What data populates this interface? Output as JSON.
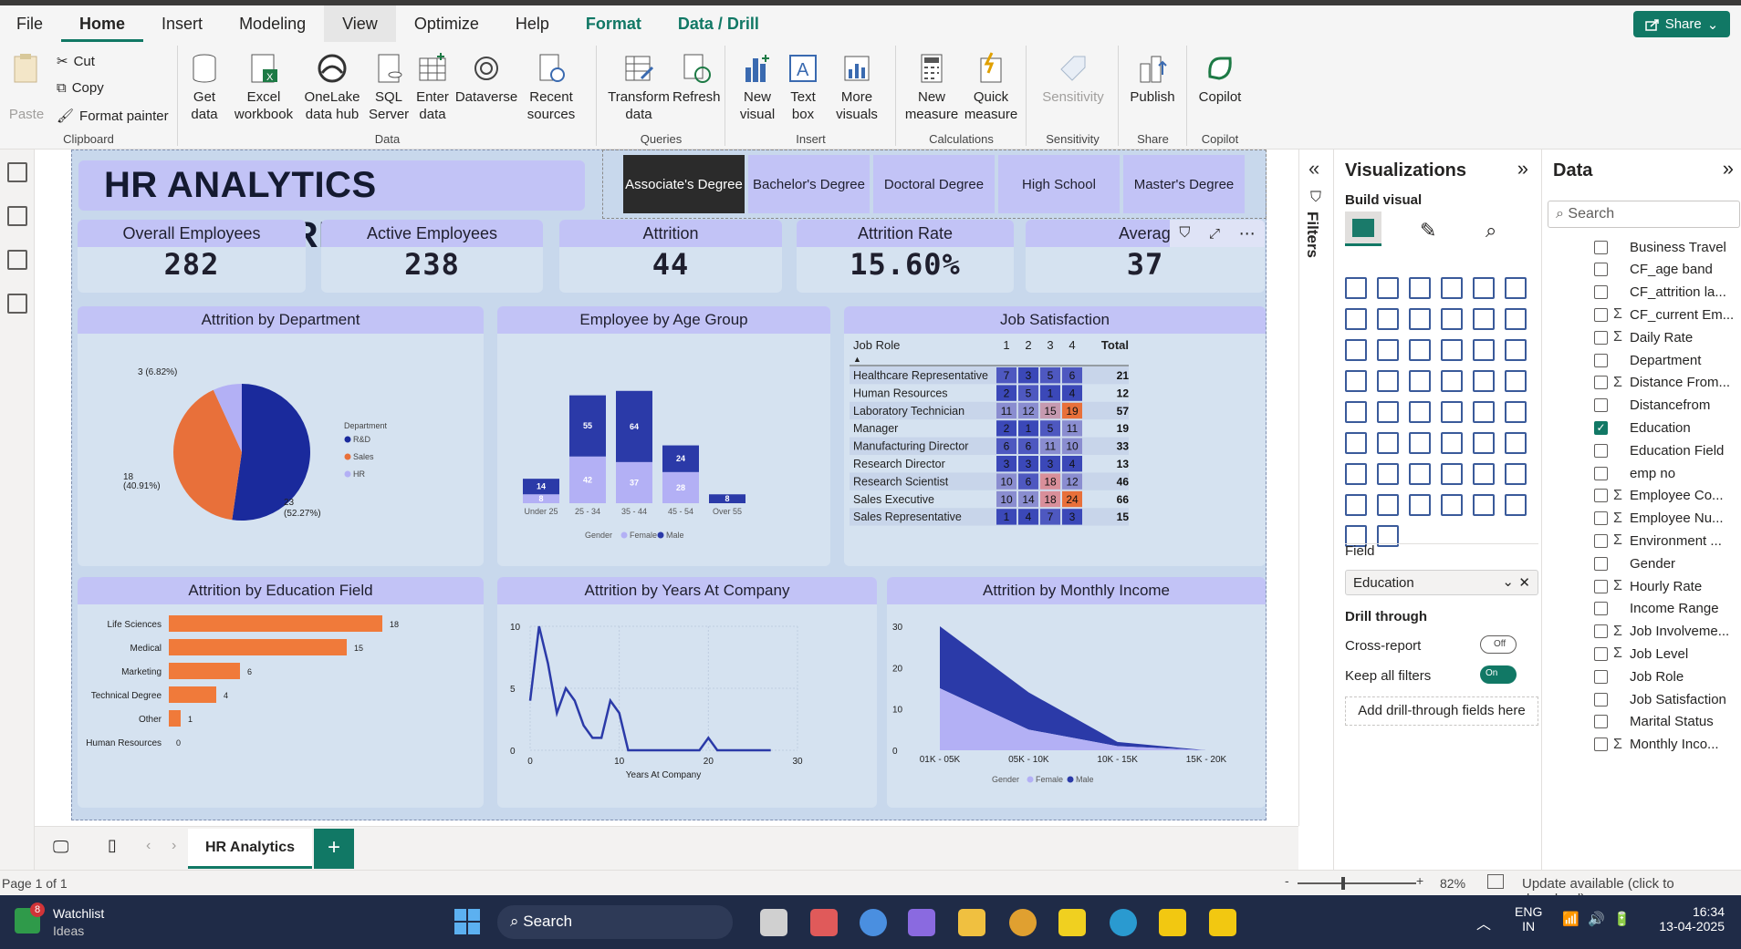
{
  "menu": {
    "items": [
      "File",
      "Home",
      "Insert",
      "Modeling",
      "View",
      "Optimize",
      "Help",
      "Format",
      "Data / Drill"
    ],
    "share": "Share"
  },
  "ribbon": {
    "clipboard": {
      "paste": "Paste",
      "cut": "Cut",
      "copy": "Copy",
      "format_painter": "Format painter",
      "label": "Clipboard"
    },
    "data": {
      "get_data": "Get data",
      "excel": "Excel workbook",
      "onelake": "OneLake data hub",
      "sql": "SQL Server",
      "enter": "Enter data",
      "dataverse": "Dataverse",
      "recent": "Recent sources",
      "label": "Data"
    },
    "queries": {
      "transform": "Transform data",
      "refresh": "Refresh",
      "label": "Queries"
    },
    "insert": {
      "new_visual": "New visual",
      "text_box": "Text box",
      "more_visuals": "More visuals",
      "label": "Insert"
    },
    "calculations": {
      "new_measure": "New measure",
      "quick_measure": "Quick measure",
      "label": "Calculations"
    },
    "sensitivity": {
      "btn": "Sensitivity",
      "label": "Sensitivity"
    },
    "share": {
      "publish": "Publish",
      "label": "Share"
    },
    "copilot": {
      "btn": "Copilot",
      "label": "Copilot"
    }
  },
  "dashboard": {
    "title": "HR ANALYTICS DASHBOARD",
    "slicers": [
      "Associate's Degree",
      "Bachelor's Degree",
      "Doctoral Degree",
      "High School",
      "Master's Degree"
    ],
    "kpis": [
      {
        "label": "Overall Employees",
        "value": "282"
      },
      {
        "label": "Active Employees",
        "value": "238"
      },
      {
        "label": "Attrition",
        "value": "44"
      },
      {
        "label": "Attrition Rate",
        "value": "15.60%"
      },
      {
        "label": "Average A",
        "value": "37"
      }
    ]
  },
  "pie_panel": {
    "title": "Attrition by Department",
    "legend_title": "Department",
    "legend": [
      "R&D",
      "Sales",
      "HR"
    ],
    "chart_data": {
      "type": "pie",
      "categories": [
        "R&D",
        "Sales",
        "HR"
      ],
      "values": [
        23,
        18,
        3
      ],
      "labels": [
        "23\n(52.27%)",
        "18\n(40.91%)",
        "3 (6.82%)"
      ],
      "colors": [
        "#1a2a9c",
        "#e8703a",
        "#b3b0f5"
      ]
    }
  },
  "age_panel": {
    "title": "Employee by Age Group",
    "legend_title": "Gender",
    "legend": [
      "Female",
      "Male"
    ],
    "chart_data": {
      "type": "bar",
      "stacked": true,
      "categories": [
        "Under 25",
        "25 - 34",
        "35 - 44",
        "45 - 54",
        "Over 55"
      ],
      "series": [
        {
          "name": "Female",
          "values": [
            8,
            42,
            37,
            28,
            0
          ],
          "color": "#b3b0f5"
        },
        {
          "name": "Male",
          "values": [
            14,
            55,
            64,
            24,
            8
          ],
          "color": "#2b3aa8"
        }
      ]
    }
  },
  "job_panel": {
    "title": "Job Satisfaction",
    "columns": [
      "Job Role",
      "1",
      "2",
      "3",
      "4",
      "Total"
    ],
    "rows": [
      {
        "role": "Healthcare Representative",
        "v": [
          7,
          3,
          5,
          6
        ],
        "total": 21
      },
      {
        "role": "Human Resources",
        "v": [
          2,
          5,
          1,
          4
        ],
        "total": 12
      },
      {
        "role": "Laboratory Technician",
        "v": [
          11,
          12,
          15,
          19
        ],
        "total": 57
      },
      {
        "role": "Manager",
        "v": [
          2,
          1,
          5,
          11
        ],
        "total": 19
      },
      {
        "role": "Manufacturing Director",
        "v": [
          6,
          6,
          11,
          10
        ],
        "total": 33
      },
      {
        "role": "Research Director",
        "v": [
          3,
          3,
          3,
          4
        ],
        "total": 13
      },
      {
        "role": "Research Scientist",
        "v": [
          10,
          6,
          18,
          12
        ],
        "total": 46
      },
      {
        "role": "Sales Executive",
        "v": [
          10,
          14,
          18,
          24
        ],
        "total": 66
      },
      {
        "role": "Sales Representative",
        "v": [
          1,
          4,
          7,
          3
        ],
        "total": 15
      }
    ]
  },
  "edu_panel": {
    "title": "Attrition by Education Field",
    "chart_data": {
      "type": "bar",
      "orientation": "horizontal",
      "categories": [
        "Life Sciences",
        "Medical",
        "Marketing",
        "Technical Degree",
        "Other",
        "Human Resources"
      ],
      "values": [
        18,
        15,
        6,
        4,
        1,
        0
      ],
      "color": "#f07a3a"
    }
  },
  "years_panel": {
    "title": "Attrition by Years At Company",
    "chart_data": {
      "type": "line",
      "xlabel": "Years At Company",
      "xlim": [
        0,
        30
      ],
      "ylim": [
        0,
        10
      ],
      "xticks": [
        "0",
        "10",
        "20",
        "30"
      ],
      "yticks": [
        "0",
        "5",
        "10"
      ],
      "x": [
        0,
        1,
        2,
        3,
        4,
        5,
        6,
        7,
        8,
        9,
        10,
        11,
        12,
        13,
        14,
        15,
        16,
        17,
        18,
        19,
        20,
        21,
        22,
        23,
        24,
        25,
        26,
        27
      ],
      "y": [
        4,
        10,
        7,
        3,
        5,
        4,
        2,
        1,
        1,
        4,
        3,
        0,
        0,
        0,
        0,
        0,
        0,
        0,
        0,
        0,
        1,
        0,
        0,
        0,
        0,
        0,
        0,
        0
      ],
      "color": "#2b3aa8"
    }
  },
  "income_panel": {
    "title": "Attrition by Monthly Income",
    "legend_title": "Gender",
    "legend": [
      "Female",
      "Male"
    ],
    "chart_data": {
      "type": "area",
      "stacked": true,
      "categories": [
        "01K - 05K",
        "05K - 10K",
        "10K - 15K",
        "15K - 20K"
      ],
      "ylim": [
        0,
        30
      ],
      "yticks": [
        "0",
        "10",
        "20",
        "30"
      ],
      "series": [
        {
          "name": "Female",
          "values": [
            15,
            5,
            1,
            0
          ],
          "color": "#b3b0f5"
        },
        {
          "name": "Male",
          "values": [
            15,
            9,
            1,
            0
          ],
          "color": "#2b3aa8"
        }
      ]
    }
  },
  "viz_pane": {
    "title": "Visualizations",
    "build": "Build visual",
    "field_label": "Field",
    "field_value": "Education",
    "drill": "Drill through",
    "cross": "Cross-report",
    "cross_state": "Off",
    "keep": "Keep all filters",
    "keep_state": "On",
    "add_drill": "Add drill-through fields here"
  },
  "filters_label": "Filters",
  "data_pane": {
    "title": "Data",
    "search": "Search",
    "fields": [
      {
        "name": "Business Travel",
        "sigma": false,
        "checked": false
      },
      {
        "name": "CF_age band",
        "sigma": false,
        "checked": false
      },
      {
        "name": "CF_attrition la...",
        "sigma": false,
        "checked": false
      },
      {
        "name": "CF_current Em...",
        "sigma": true,
        "checked": false
      },
      {
        "name": "Daily Rate",
        "sigma": true,
        "checked": false
      },
      {
        "name": "Department",
        "sigma": false,
        "checked": false
      },
      {
        "name": "Distance From...",
        "sigma": true,
        "checked": false
      },
      {
        "name": "Distancefrom",
        "sigma": false,
        "checked": false
      },
      {
        "name": "Education",
        "sigma": false,
        "checked": true
      },
      {
        "name": "Education Field",
        "sigma": false,
        "checked": false
      },
      {
        "name": "emp no",
        "sigma": false,
        "checked": false
      },
      {
        "name": "Employee Co...",
        "sigma": true,
        "checked": false
      },
      {
        "name": "Employee Nu...",
        "sigma": true,
        "checked": false
      },
      {
        "name": "Environment ...",
        "sigma": true,
        "checked": false
      },
      {
        "name": "Gender",
        "sigma": false,
        "checked": false
      },
      {
        "name": "Hourly Rate",
        "sigma": true,
        "checked": false
      },
      {
        "name": "Income Range",
        "sigma": false,
        "checked": false
      },
      {
        "name": "Job Involveme...",
        "sigma": true,
        "checked": false
      },
      {
        "name": "Job Level",
        "sigma": true,
        "checked": false
      },
      {
        "name": "Job Role",
        "sigma": false,
        "checked": false
      },
      {
        "name": "Job Satisfaction",
        "sigma": false,
        "checked": false
      },
      {
        "name": "Marital Status",
        "sigma": false,
        "checked": false
      },
      {
        "name": "Monthly Inco...",
        "sigma": true,
        "checked": false
      }
    ]
  },
  "tabs": {
    "page": "HR Analytics",
    "add": "+"
  },
  "status": {
    "page": "Page 1 of 1",
    "zoom": "82%",
    "update": "Update available (click to download)",
    "minus": "-",
    "plus": "+"
  },
  "taskbar": {
    "badge": "8",
    "watch_title": "Watchlist",
    "watch_sub": "Ideas",
    "search": "Search",
    "lang1": "ENG",
    "lang2": "IN",
    "time": "16:34",
    "date": "13-04-2025"
  }
}
